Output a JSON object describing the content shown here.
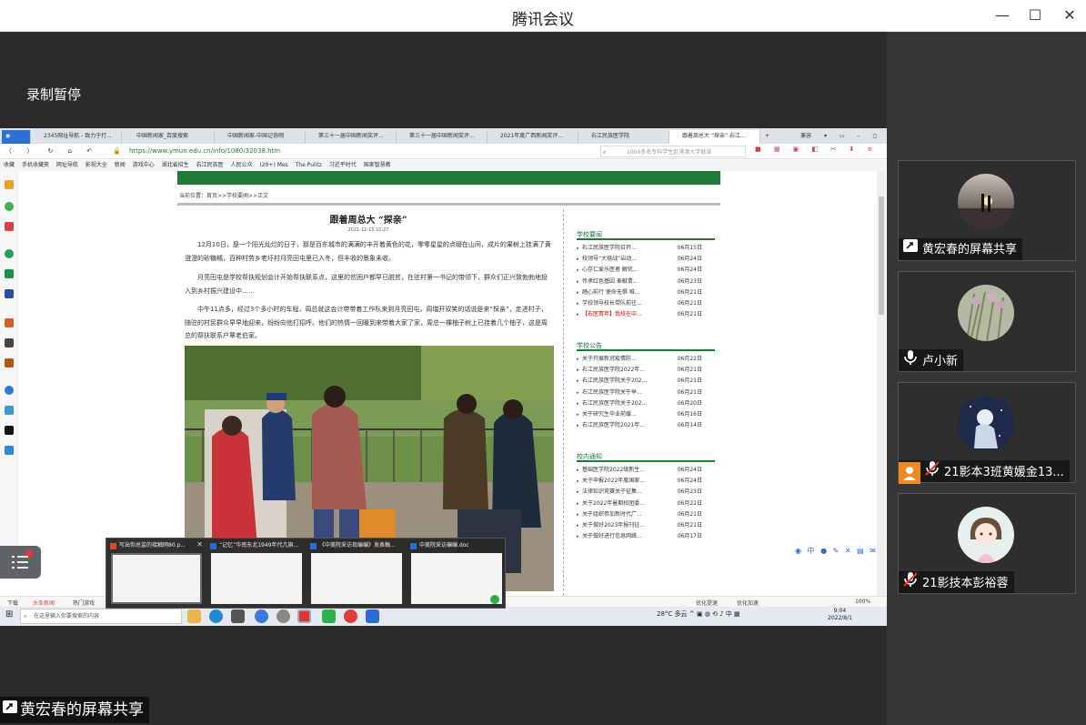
{
  "window": {
    "title": "腾讯会议",
    "recording_status": "录制暂停",
    "bottom_label": "黄宏春的屏幕共享"
  },
  "participants": [
    {
      "name": "黄宏春的屏幕共享",
      "icon": "screen-share-icon"
    },
    {
      "name": "卢小新",
      "icon": "microphone-icon"
    },
    {
      "name": "21影本3班黄媛金13...",
      "icon": "mic-muted-icon"
    },
    {
      "name": "21影技本彭裕蓉",
      "icon": "mic-muted-icon"
    }
  ],
  "shared": {
    "tabs": [
      "2345网址导航 - 致力于打...",
      "中国新闻家_百度搜索",
      "中国新闻家-中国记协网",
      "第三十一届中国新闻奖评...",
      "第三十一届中国新闻奖评...",
      "2021年度广西新闻奖评...",
      "右江民族医学院",
      "跟着周总大 “探亲” 右江..."
    ],
    "browser_mode": "兼容",
    "url": "https://www.ymun.edu.cn/info/1080/32038.htm",
    "search_placeholder": "1000多名专科学生赴港澳大学就读",
    "bookmarks": [
      "收藏",
      "手机收藏夹",
      "网址导航",
      "影视大全",
      "新闻",
      "游戏中心",
      "湖北省招生",
      "右江民族医",
      "人民公众",
      "(20+) Mes",
      "The Pulitz",
      "习近平时代",
      "国家智慧教"
    ],
    "breadcrumb": "当前位置：首页>>学校要闻>>正文",
    "article": {
      "title": "跟着周总大 “探亲”",
      "date": "2021-12-15  10:27",
      "paragraphs": [
        "12月10日，是一个阳光灿烂的日子，那是百东城市的满满的丰开着黄色的花，零零星星的点缀在山间，成片的果树上挂满了黄澄澄的砂糖橘，百种村劳乡老圩村月亮田屯里已入冬，但丰收的景象未收。",
        "月亮田屯是学校帮扶规划会计开始帮扶联系点，这里的贫困户都早已脱贫，在驻村第一书记的带领下，群众们正兴致勃勃地投入到乡村振兴建设中……",
        "中午11点多，经过3个多小时的车程，周总就这会计带带着工作队来到月亮田屯，周瑞开双笑的话说是来“探亲”，走进村子，随驻的村民群众早早地迎来，纷纷向他打招呼。他们的热情一回暖到来带着大家了家，周总一棵柚子树上已挂着几个柚子，这是周总的帮扶联系户覃老伯家。"
      ]
    },
    "sections": [
      {
        "title": "学校要闻",
        "items": [
          {
            "text": "右江民族医学院召开...",
            "date": "06月15日"
          },
          {
            "text": "校领导“大挑战”启动...",
            "date": "06月24日"
          },
          {
            "text": "心存仁爱乐医者 解忧...",
            "date": "06月24日"
          },
          {
            "text": "传承红色基因 奉献青...",
            "date": "06月23日"
          },
          {
            "text": "踏心前行 使命无惧 唯...",
            "date": "06月21日"
          },
          {
            "text": "学校领导校长带队前往...",
            "date": "06月21日"
          },
          {
            "text": "【右医青年】我校在中...",
            "date": "06月21日",
            "red": true
          }
        ]
      },
      {
        "title": "学校公告",
        "items": [
          {
            "text": "关于开展新冠疫情防...",
            "date": "06月22日"
          },
          {
            "text": "右江民族医学院2022年...",
            "date": "06月21日"
          },
          {
            "text": "右江民族医学院关于202...",
            "date": "06月21日"
          },
          {
            "text": "右江民族医学院关于举...",
            "date": "06月21日"
          },
          {
            "text": "右江民族医学院关于202...",
            "date": "06月20日"
          },
          {
            "text": "关于研究生毕业前缓...",
            "date": "06月16日"
          },
          {
            "text": "右江民族医学院2021年...",
            "date": "06月14日"
          }
        ]
      },
      {
        "title": "校内通知",
        "items": [
          {
            "text": "基础医学院2022级新生...",
            "date": "06月24日"
          },
          {
            "text": "关于申报2022年度国家...",
            "date": "06月24日"
          },
          {
            "text": "法律知识竞赛关于征集...",
            "date": "06月23日"
          },
          {
            "text": "关于2022年暑期校团委...",
            "date": "06月22日"
          },
          {
            "text": "关于组织参加新时代广...",
            "date": "06月21日"
          },
          {
            "text": "关于做好2023年报刊征...",
            "date": "06月21日"
          },
          {
            "text": "关于做好进行信息网络...",
            "date": "06月17日"
          }
        ]
      }
    ],
    "status": [
      "下载",
      "头条新闻",
      "热门游戏"
    ],
    "status_right": [
      "优化提速",
      "优化加速",
      "100%"
    ],
    "taskbar": {
      "search_placeholder": "在这里输入你要搜索的内容",
      "weather": "28°C 多云",
      "time": "9:04",
      "date": "2022/8/1",
      "ime": "中"
    },
    "thumbnails": [
      {
        "caption": "写出你总监的接触网80.p..."
      },
      {
        "caption": "“记忆”华南东北1949年代几旗..."
      },
      {
        "caption": "《中美院采访现编编》发表稿..."
      },
      {
        "caption": "中美院采访编编.doc"
      }
    ]
  },
  "colors": {
    "brand_green": "#1f7a3a",
    "panel_bg": "#363636",
    "main_bg": "#2b2b2b"
  }
}
